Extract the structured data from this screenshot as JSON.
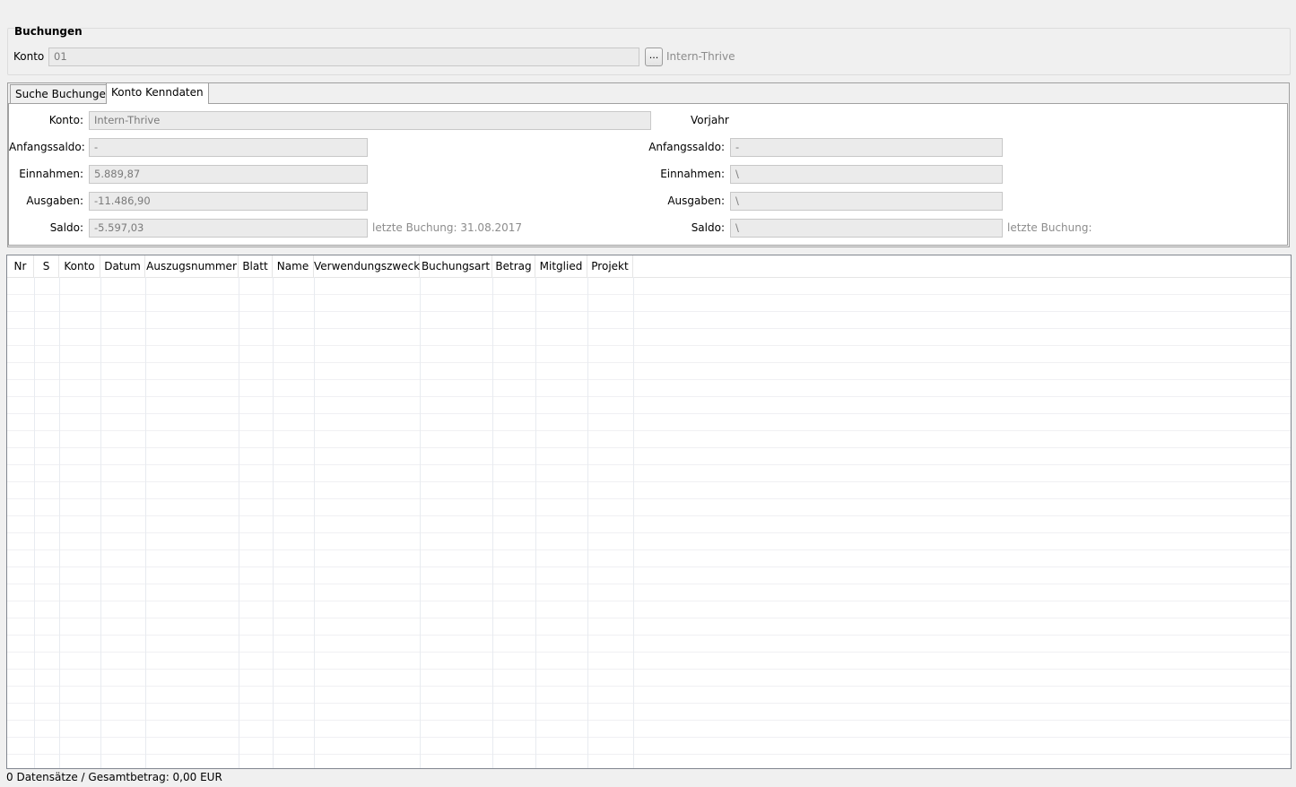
{
  "group": {
    "title": "Buchungen"
  },
  "konto": {
    "label": "Konto",
    "value": "01",
    "browse_label": "...",
    "name": "Intern-Thrive"
  },
  "tabs": [
    {
      "label": "Suche Buchungen",
      "active": false
    },
    {
      "label": "Konto Kenndaten",
      "active": true
    }
  ],
  "kenndaten": {
    "current": {
      "konto_label": "Konto:",
      "konto_value": "Intern-Thrive",
      "anfangssaldo_label": "Anfangssaldo:",
      "anfangssaldo_value": "-",
      "einnahmen_label": "Einnahmen:",
      "einnahmen_value": "5.889,87",
      "ausgaben_label": "Ausgaben:",
      "ausgaben_value": "-11.486,90",
      "saldo_label": "Saldo:",
      "saldo_value": "-5.597,03",
      "letzte_buchung": "letzte Buchung: 31.08.2017"
    },
    "previous": {
      "title": "Vorjahr",
      "anfangssaldo_label": "Anfangssaldo:",
      "anfangssaldo_value": "-",
      "einnahmen_label": "Einnahmen:",
      "einnahmen_value": "\\",
      "ausgaben_label": "Ausgaben:",
      "ausgaben_value": "\\",
      "saldo_label": "Saldo:",
      "saldo_value": "\\",
      "letzte_buchung": "letzte Buchung:"
    }
  },
  "table": {
    "columns": [
      "Nr",
      "S",
      "Konto",
      "Datum",
      "Auszugsnummer",
      "Blatt",
      "Name",
      "Verwendungszweck",
      "Buchungsart",
      "Betrag",
      "Mitglied",
      "Projekt"
    ],
    "rows": []
  },
  "status": {
    "text": "0 Datensätze / Gesamtbetrag: 0,00 EUR"
  }
}
